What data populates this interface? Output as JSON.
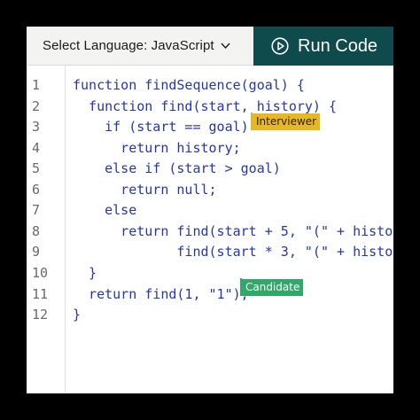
{
  "toolbar": {
    "language_label": "Select Language: JavaScript",
    "run_label": "Run Code",
    "colors": {
      "run_bg": "#0f4a4c",
      "lang_bg": "#f3f3f1"
    }
  },
  "gutter": [
    "1",
    "2",
    "3",
    "4",
    "5",
    "6",
    "7",
    "8",
    "9",
    "10",
    "11",
    "12"
  ],
  "code": {
    "lines": [
      "function findSequence(goal) {",
      "  function find(start, history) {",
      "    if (start == goal)",
      "      return history;",
      "    else if (start > goal)",
      "      return null;",
      "    else",
      "      return find(start + 5, \"(\" + histo",
      "             find(start * 3, \"(\" + histo",
      "  }",
      "  return find(1, \"1\");",
      "}"
    ]
  },
  "collaborators": {
    "interviewer": {
      "label": "Interviewer",
      "color": "#e8b824"
    },
    "candidate": {
      "label": "Candidate",
      "color": "#2fa868"
    }
  }
}
